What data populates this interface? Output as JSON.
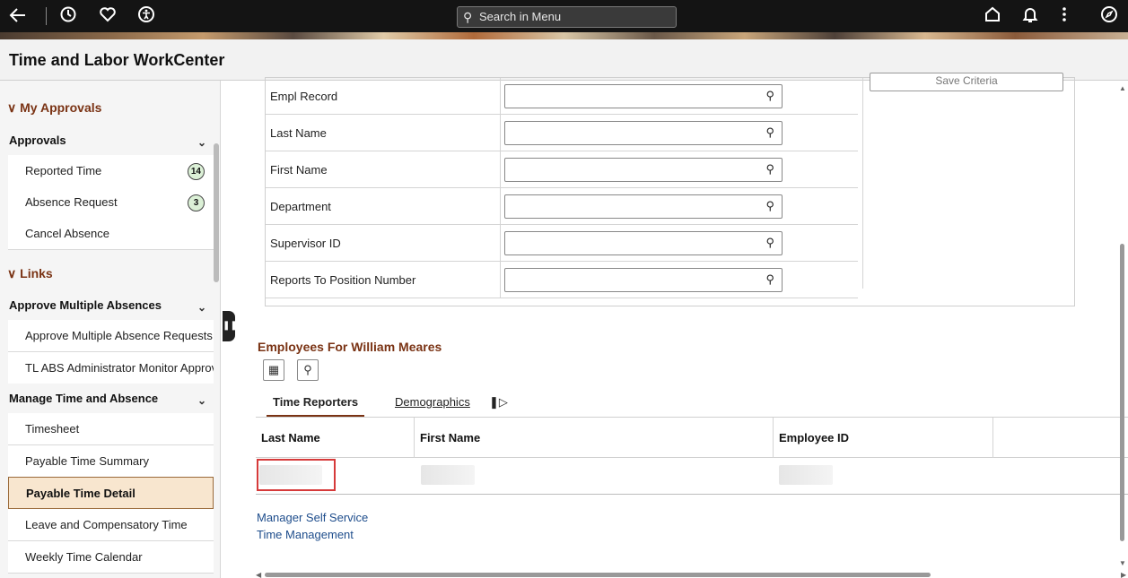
{
  "topbar": {
    "back_icon": "arrow-left-icon",
    "recent_icon": "clock-icon",
    "favorites_icon": "heart-icon",
    "accessibility_icon": "accessibility-icon",
    "search_placeholder": "Search in Menu",
    "home_icon": "home-icon",
    "notifications_icon": "bell-icon",
    "actions_icon": "more-vertical-icon",
    "navbar_icon": "compass-icon"
  },
  "page": {
    "title": "Time and Labor WorkCenter"
  },
  "sidebar": {
    "sections": [
      {
        "label": "My Approvals"
      },
      {
        "label": "Links"
      }
    ],
    "groups": [
      {
        "label": "Approvals"
      },
      {
        "label": "Approve Multiple Absences"
      },
      {
        "label": "Manage Time and Absence"
      }
    ],
    "items": [
      {
        "label": "Reported Time",
        "badge": "14"
      },
      {
        "label": "Absence Request",
        "badge": "3"
      },
      {
        "label": "Cancel Absence"
      },
      {
        "label": "Approve Multiple Absence Requests"
      },
      {
        "label": "TL ABS Administrator Monitor Approva"
      },
      {
        "label": "Timesheet"
      },
      {
        "label": "Payable Time Summary"
      },
      {
        "label": "Payable Time Detail",
        "selected": true
      },
      {
        "label": "Leave and Compensatory Time"
      },
      {
        "label": "Weekly Time Calendar"
      }
    ]
  },
  "criteria": {
    "fields": [
      {
        "label": "Empl Record",
        "value": ""
      },
      {
        "label": "Last Name",
        "value": ""
      },
      {
        "label": "First Name",
        "value": ""
      },
      {
        "label": "Department",
        "value": ""
      },
      {
        "label": "Supervisor ID",
        "value": ""
      },
      {
        "label": "Reports To Position Number",
        "value": ""
      }
    ],
    "save_button": "Save Criteria"
  },
  "employees": {
    "title": "Employees For William Meares",
    "tabs": [
      {
        "label": "Time Reporters",
        "active": true
      },
      {
        "label": "Demographics"
      }
    ],
    "columns": [
      "Last Name",
      "First Name",
      "Employee ID"
    ]
  },
  "links": [
    "Manager Self Service",
    "Time Management"
  ]
}
